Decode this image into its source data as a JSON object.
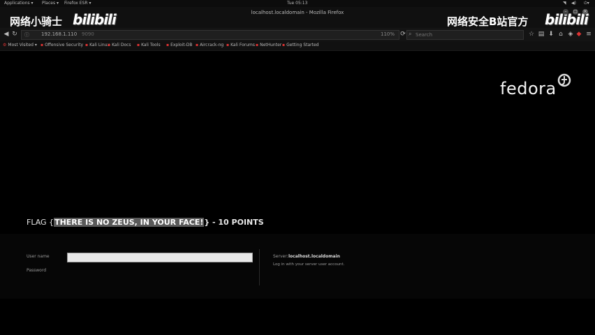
{
  "topbar": {
    "applications": "Applications ▾",
    "places": "Places ▾",
    "firefox": "Firefox ESR ▾",
    "clock": "Tue 05:13"
  },
  "window": {
    "title": "localhost.localdomain - Mozilla Firefox"
  },
  "watermark": {
    "left_text": "网络小骑士",
    "left_logo": "bilibili",
    "right_text": "网络安全B站官方",
    "right_logo": "bilibili"
  },
  "navbar": {
    "url": "192.168.1.110",
    "url_suffix": "9090",
    "zoom": "110%",
    "search_placeholder": "Search"
  },
  "bookmarks": [
    {
      "label": "Most Visited ▾"
    },
    {
      "label": "Offensive Security"
    },
    {
      "label": "Kali Linux"
    },
    {
      "label": "Kali Docs"
    },
    {
      "label": "Kali Tools"
    },
    {
      "label": "Exploit-DB"
    },
    {
      "label": "Aircrack-ng"
    },
    {
      "label": "Kali Forums"
    },
    {
      "label": "NetHunter"
    },
    {
      "label": "Getting Started"
    }
  ],
  "page": {
    "logo": "fedora",
    "flag_prefix": "FLAG {",
    "flag_text": "THERE IS NO ZEUS, IN YOUR FACE!",
    "flag_suffix": "} - 10 POINTS",
    "username_label": "User name",
    "password_label": "Password",
    "server_label": "Server:",
    "server_value": "localhost.localdomain",
    "server_hint": "Log in with your server user account."
  }
}
